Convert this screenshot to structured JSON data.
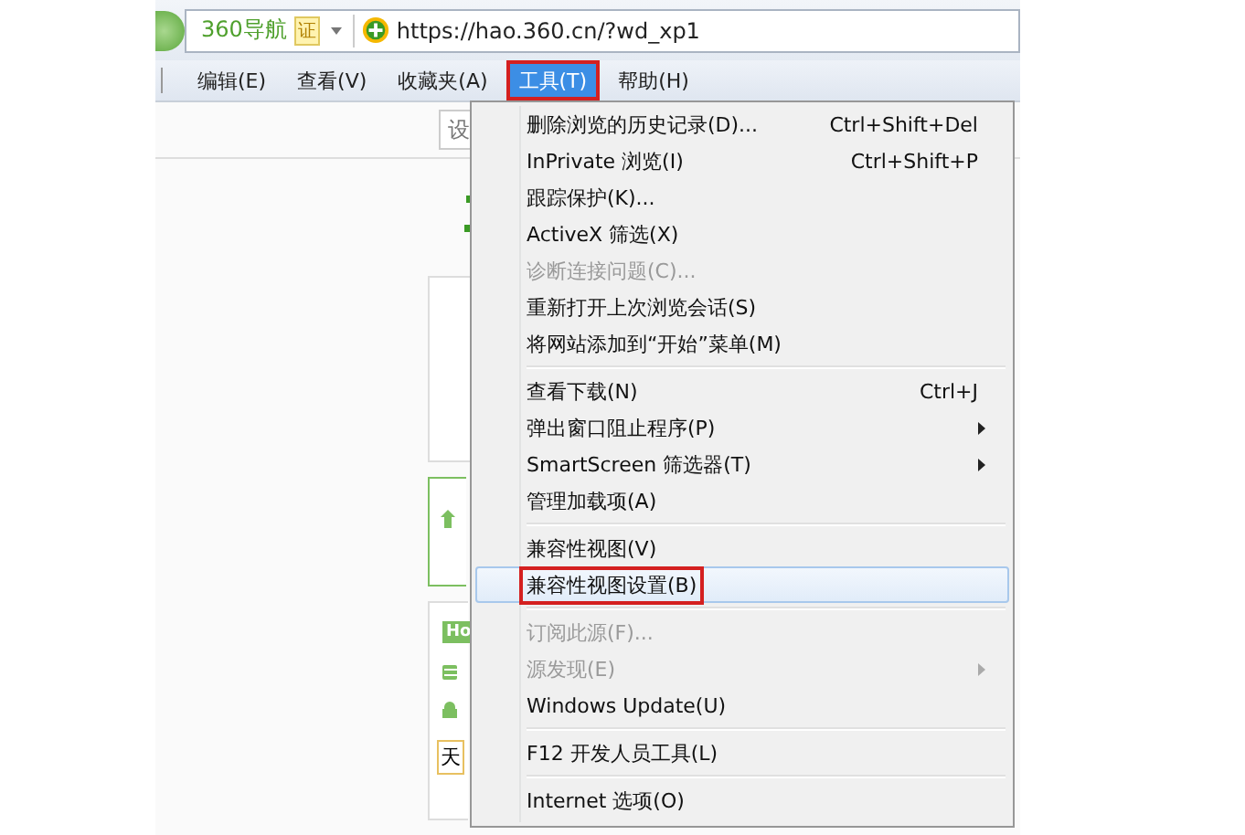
{
  "address_bar": {
    "site_label": "360导航",
    "cert_badge": "证",
    "url": "https://hao.360.cn/?wd_xp1"
  },
  "menu_bar": [
    {
      "label": "编辑(E)",
      "selected": false,
      "annotated": false
    },
    {
      "label": "查看(V)",
      "selected": false,
      "annotated": false
    },
    {
      "label": "收藏夹(A)",
      "selected": false,
      "annotated": false
    },
    {
      "label": "工具(T)",
      "selected": true,
      "annotated": true
    },
    {
      "label": "帮助(H)",
      "selected": false,
      "annotated": false
    }
  ],
  "page": {
    "search_text": "设",
    "badge_text": "Ho",
    "field_text": "天"
  },
  "tools_menu": [
    {
      "kind": "item",
      "label": "删除浏览的历史记录(D)...",
      "shortcut": "Ctrl+Shift+Del",
      "disabled": false,
      "submenu": false,
      "selected": false,
      "annotated": false
    },
    {
      "kind": "item",
      "label": "InPrivate 浏览(I)",
      "shortcut": "Ctrl+Shift+P",
      "disabled": false,
      "submenu": false,
      "selected": false,
      "annotated": false
    },
    {
      "kind": "item",
      "label": "跟踪保护(K)...",
      "disabled": false,
      "submenu": false,
      "selected": false,
      "annotated": false
    },
    {
      "kind": "item",
      "label": "ActiveX 筛选(X)",
      "disabled": false,
      "submenu": false,
      "selected": false,
      "annotated": false
    },
    {
      "kind": "item",
      "label": "诊断连接问题(C)...",
      "disabled": true,
      "submenu": false,
      "selected": false,
      "annotated": false
    },
    {
      "kind": "item",
      "label": "重新打开上次浏览会话(S)",
      "disabled": false,
      "submenu": false,
      "selected": false,
      "annotated": false
    },
    {
      "kind": "item",
      "label": "将网站添加到“开始”菜单(M)",
      "disabled": false,
      "submenu": false,
      "selected": false,
      "annotated": false
    },
    {
      "kind": "separator"
    },
    {
      "kind": "item",
      "label": "查看下载(N)",
      "shortcut": "Ctrl+J",
      "disabled": false,
      "submenu": false,
      "selected": false,
      "annotated": false
    },
    {
      "kind": "item",
      "label": "弹出窗口阻止程序(P)",
      "disabled": false,
      "submenu": true,
      "selected": false,
      "annotated": false
    },
    {
      "kind": "item",
      "label": "SmartScreen 筛选器(T)",
      "disabled": false,
      "submenu": true,
      "selected": false,
      "annotated": false
    },
    {
      "kind": "item",
      "label": "管理加载项(A)",
      "disabled": false,
      "submenu": false,
      "selected": false,
      "annotated": false
    },
    {
      "kind": "separator"
    },
    {
      "kind": "item",
      "label": "兼容性视图(V)",
      "disabled": false,
      "submenu": false,
      "selected": false,
      "annotated": false
    },
    {
      "kind": "item",
      "label": "兼容性视图设置(B)",
      "disabled": false,
      "submenu": false,
      "selected": true,
      "annotated": true
    },
    {
      "kind": "separator"
    },
    {
      "kind": "item",
      "label": "订阅此源(F)...",
      "disabled": true,
      "submenu": false,
      "selected": false,
      "annotated": false
    },
    {
      "kind": "item",
      "label": "源发现(E)",
      "disabled": true,
      "submenu": true,
      "selected": false,
      "annotated": false
    },
    {
      "kind": "item",
      "label": "Windows Update(U)",
      "disabled": false,
      "submenu": false,
      "selected": false,
      "annotated": false
    },
    {
      "kind": "separator"
    },
    {
      "kind": "item",
      "label": "F12 开发人员工具(L)",
      "disabled": false,
      "submenu": false,
      "selected": false,
      "annotated": false
    },
    {
      "kind": "separator"
    },
    {
      "kind": "item",
      "label": "Internet 选项(O)",
      "disabled": false,
      "submenu": false,
      "selected": false,
      "annotated": false
    }
  ]
}
